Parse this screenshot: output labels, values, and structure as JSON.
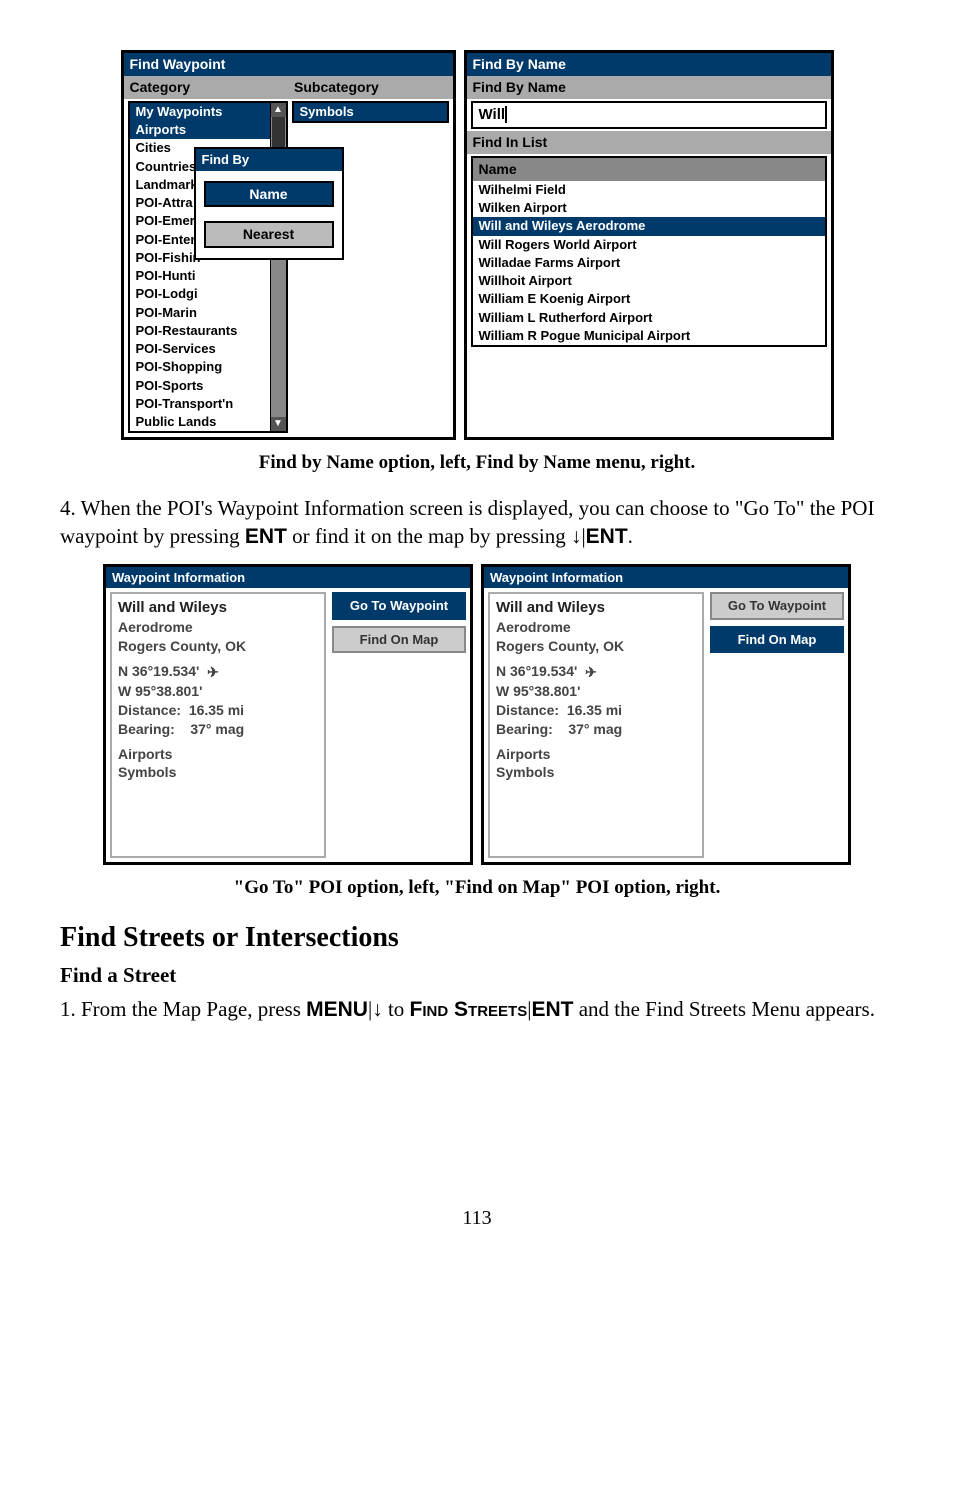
{
  "figure1": {
    "left": {
      "title": "Find Waypoint",
      "cat_label": "Category",
      "sub_label": "Subcategory",
      "categories": [
        "My Waypoints",
        "Airports",
        "Cities",
        "Countries",
        "Landmarks",
        "POI-Attra",
        "POI-Emer",
        "POI-Enter",
        "POI-Fishin",
        "POI-Hunti",
        "POI-Lodgi",
        "POI-Marin",
        "POI-Restaurants",
        "POI-Services",
        "POI-Shopping",
        "POI-Sports",
        "POI-Transport'n",
        "Public Lands"
      ],
      "subcategory": "Symbols",
      "popup_title": "Find By",
      "popup_items": [
        "Name",
        "Nearest"
      ]
    },
    "right": {
      "title": "Find By Name",
      "subtitle": "Find By Name",
      "input": "Will",
      "list_label": "Find In List",
      "name_label": "Name",
      "items": [
        "Wilhelmi Field",
        "Wilken Airport",
        "Will and Wileys Aerodrome",
        "Will Rogers World Airport",
        "Willadae Farms Airport",
        "Willhoit Airport",
        "William E Koenig Airport",
        "William L Rutherford Airport",
        "William R Pogue Municipal Airport"
      ],
      "selected_index": 2
    },
    "caption": "Find by Name option, left, Find by Name menu, right."
  },
  "para1_prefix": "4. When the POI's Waypoint Information screen is displayed, you can choose to \"Go To\" the POI waypoint by pressing ",
  "para1_ent": "ENT",
  "para1_mid": " or find it on the map by pressing ↓|",
  "para1_ent2": "ENT",
  "para1_suffix": ".",
  "figure2": {
    "header": "Waypoint Information",
    "name": "Will and Wileys",
    "sub": "Aerodrome",
    "county": "Rogers County, OK",
    "lat": "N   36°19.534'",
    "lon": "W   95°38.801'",
    "distance_label": "Distance:",
    "distance": "16.35 mi",
    "bearing_label": "Bearing:",
    "bearing": "37° mag",
    "cat": "Airports",
    "subcat": "Symbols",
    "btn_goto": "Go To Waypoint",
    "btn_map": "Find On Map",
    "caption": "\"Go To\" POI option, left, \"Find on Map\" POI option, right."
  },
  "h2": "Find Streets or Intersections",
  "h3": "Find a Street",
  "para2_prefix": "1. From the Map Page, press ",
  "para2_menu": "MENU",
  "para2_mid1": "|↓ to ",
  "para2_find_streets": "Find Streets",
  "para2_mid2": "|",
  "para2_ent": "ENT",
  "para2_suffix": " and the Find Streets Menu appears.",
  "page_num": "113"
}
